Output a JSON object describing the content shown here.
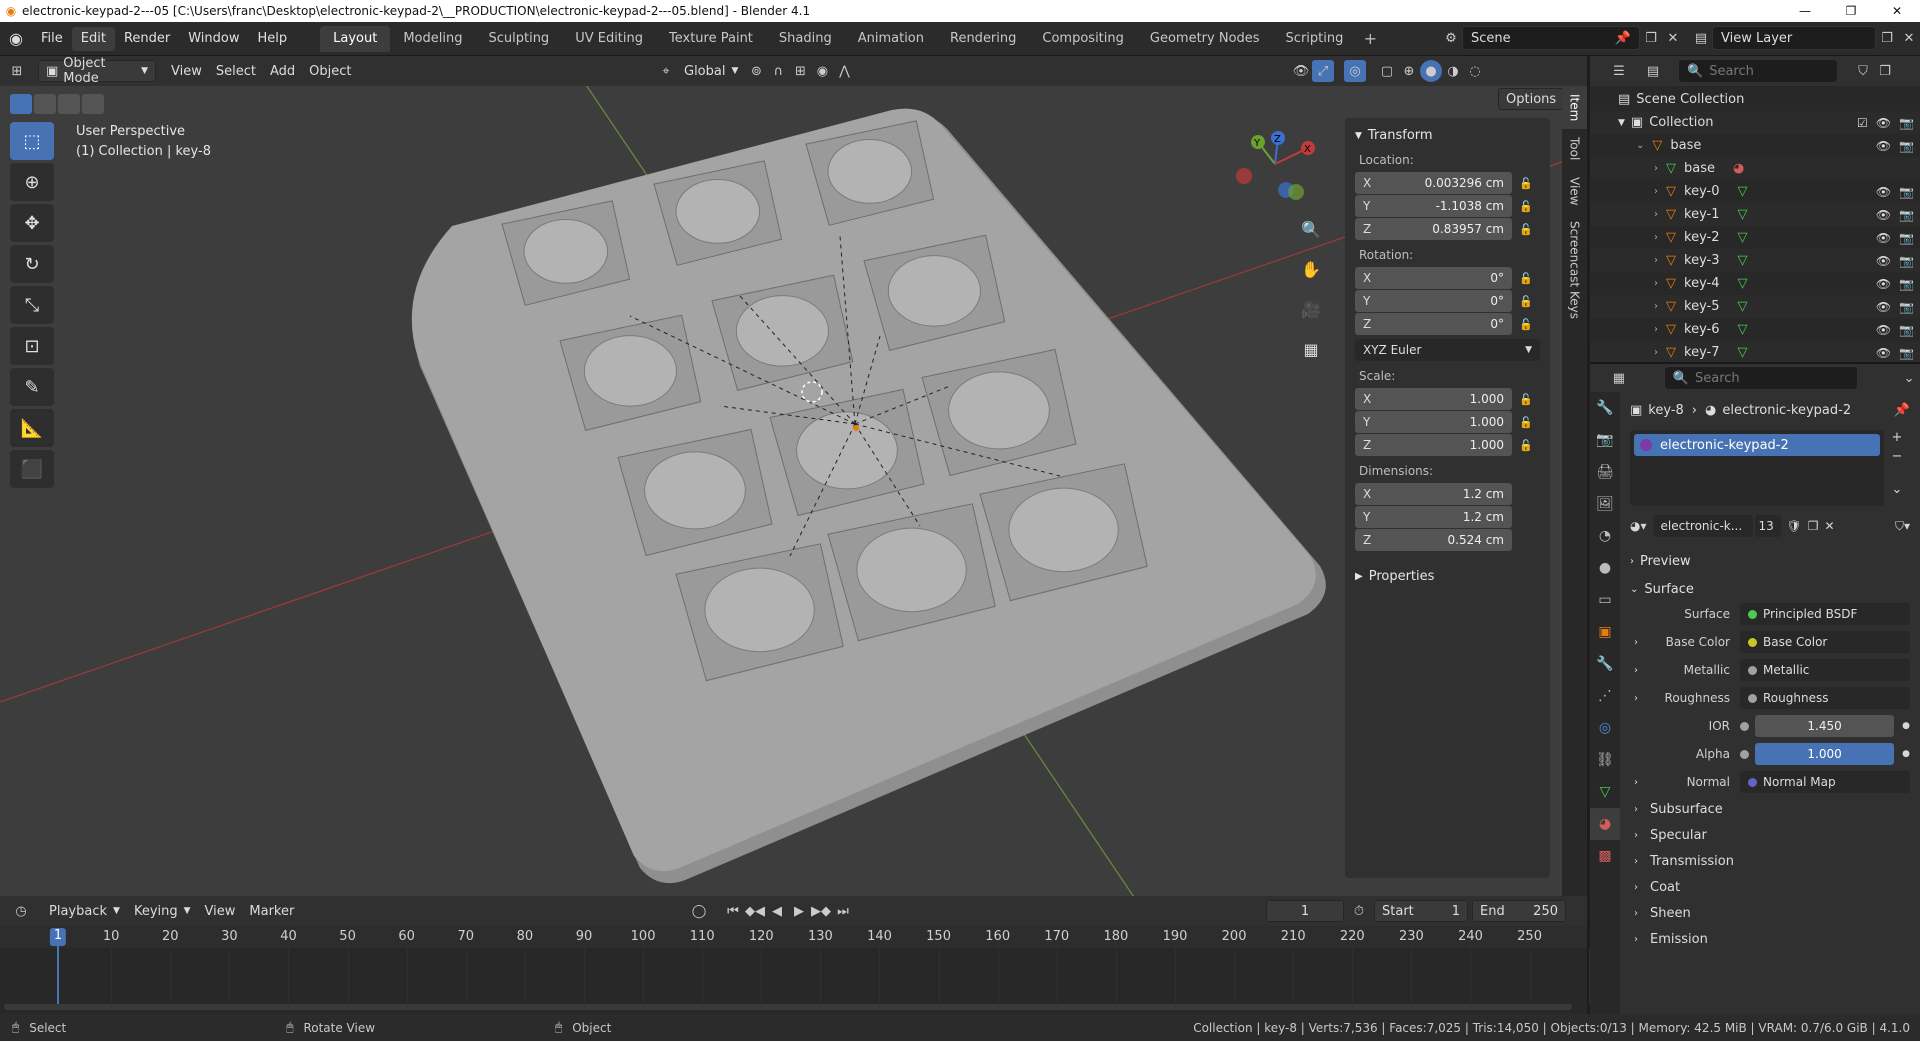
{
  "window": {
    "title": "electronic-keypad-2---05 [C:\\Users\\franc\\Desktop\\electronic-keypad-2\\__PRODUCTION\\electronic-keypad-2---05.blend] - Blender 4.1",
    "min": "—",
    "max": "❐",
    "close": "✕"
  },
  "menubar": {
    "menus": [
      "File",
      "Edit",
      "Render",
      "Window",
      "Help"
    ],
    "workspaces": [
      "Layout",
      "Modeling",
      "Sculpting",
      "UV Editing",
      "Texture Paint",
      "Shading",
      "Animation",
      "Rendering",
      "Compositing",
      "Geometry Nodes",
      "Scripting"
    ],
    "scene": "Scene",
    "view_layer": "View Layer"
  },
  "viewport_header": {
    "mode": "Object Mode",
    "menus": [
      "View",
      "Select",
      "Add",
      "Object"
    ],
    "orientation": "Global",
    "options": "Options"
  },
  "viewport": {
    "perspective": "User Perspective",
    "collection_line": "(1) Collection | key-8"
  },
  "npanel": {
    "transform_title": "Transform",
    "location_label": "Location:",
    "location": [
      {
        "ax": "X",
        "v": "0.003296 cm"
      },
      {
        "ax": "Y",
        "v": "-1.1038 cm"
      },
      {
        "ax": "Z",
        "v": "0.83957 cm"
      }
    ],
    "rotation_label": "Rotation:",
    "rotation": [
      {
        "ax": "X",
        "v": "0°"
      },
      {
        "ax": "Y",
        "v": "0°"
      },
      {
        "ax": "Z",
        "v": "0°"
      }
    ],
    "rotation_mode": "XYZ Euler",
    "scale_label": "Scale:",
    "scale": [
      {
        "ax": "X",
        "v": "1.000"
      },
      {
        "ax": "Y",
        "v": "1.000"
      },
      {
        "ax": "Z",
        "v": "1.000"
      }
    ],
    "dimensions_label": "Dimensions:",
    "dimensions": [
      {
        "ax": "X",
        "v": "1.2 cm"
      },
      {
        "ax": "Y",
        "v": "1.2 cm"
      },
      {
        "ax": "Z",
        "v": "0.524 cm"
      }
    ],
    "properties": "Properties",
    "tabs": [
      "Item",
      "Tool",
      "View",
      "Screencast Keys"
    ]
  },
  "outliner": {
    "search_placeholder": "Search",
    "scene_collection": "Scene Collection",
    "collection": "Collection",
    "items": [
      "base",
      "base",
      "key-0",
      "key-1",
      "key-2",
      "key-3",
      "key-4",
      "key-5",
      "key-6",
      "key-7"
    ]
  },
  "properties": {
    "search_placeholder": "Search",
    "breadcrumb_object": "key-8",
    "breadcrumb_material": "electronic-keypad-2",
    "material_slot": "electronic-keypad-2",
    "material_name": "electronic-k...",
    "users": "13",
    "preview": "Preview",
    "surface_section": "Surface",
    "surface_label": "Surface",
    "surface_value": "Principled BSDF",
    "inputs": [
      {
        "label": "Base Color",
        "value": "Base Color",
        "color": "#c7c729"
      },
      {
        "label": "Metallic",
        "value": "Metallic",
        "color": "#a1a1a1"
      },
      {
        "label": "Roughness",
        "value": "Roughness",
        "color": "#a1a1a1"
      }
    ],
    "ior_label": "IOR",
    "ior": "1.450",
    "alpha_label": "Alpha",
    "alpha": "1.000",
    "normal_label": "Normal",
    "normal_value": "Normal Map",
    "subsections": [
      "Subsurface",
      "Specular",
      "Transmission",
      "Coat",
      "Sheen",
      "Emission"
    ]
  },
  "timeline": {
    "menus": [
      "Playback",
      "Keying",
      "View",
      "Marker"
    ],
    "current_frame": "1",
    "start_label": "Start",
    "start": "1",
    "end_label": "End",
    "end": "250",
    "ruler": [
      "1",
      "10",
      "20",
      "30",
      "40",
      "50",
      "60",
      "70",
      "80",
      "90",
      "100",
      "110",
      "120",
      "130",
      "140",
      "150",
      "160",
      "170",
      "180",
      "190",
      "200",
      "210",
      "220",
      "230",
      "240",
      "250"
    ]
  },
  "statusbar": {
    "select": "Select",
    "rotate": "Rotate View",
    "object": "Object",
    "stats": "Collection | key-8 | Verts:7,536 | Faces:7,025 | Tris:14,050 | Objects:0/13 | Memory: 42.5 MiB | VRAM: 0.7/6.0 GiB | 4.1.0"
  },
  "colors": {
    "accent": "#4772b3",
    "object_orange": "#e87d0d",
    "mesh_green": "#4ec94e"
  }
}
